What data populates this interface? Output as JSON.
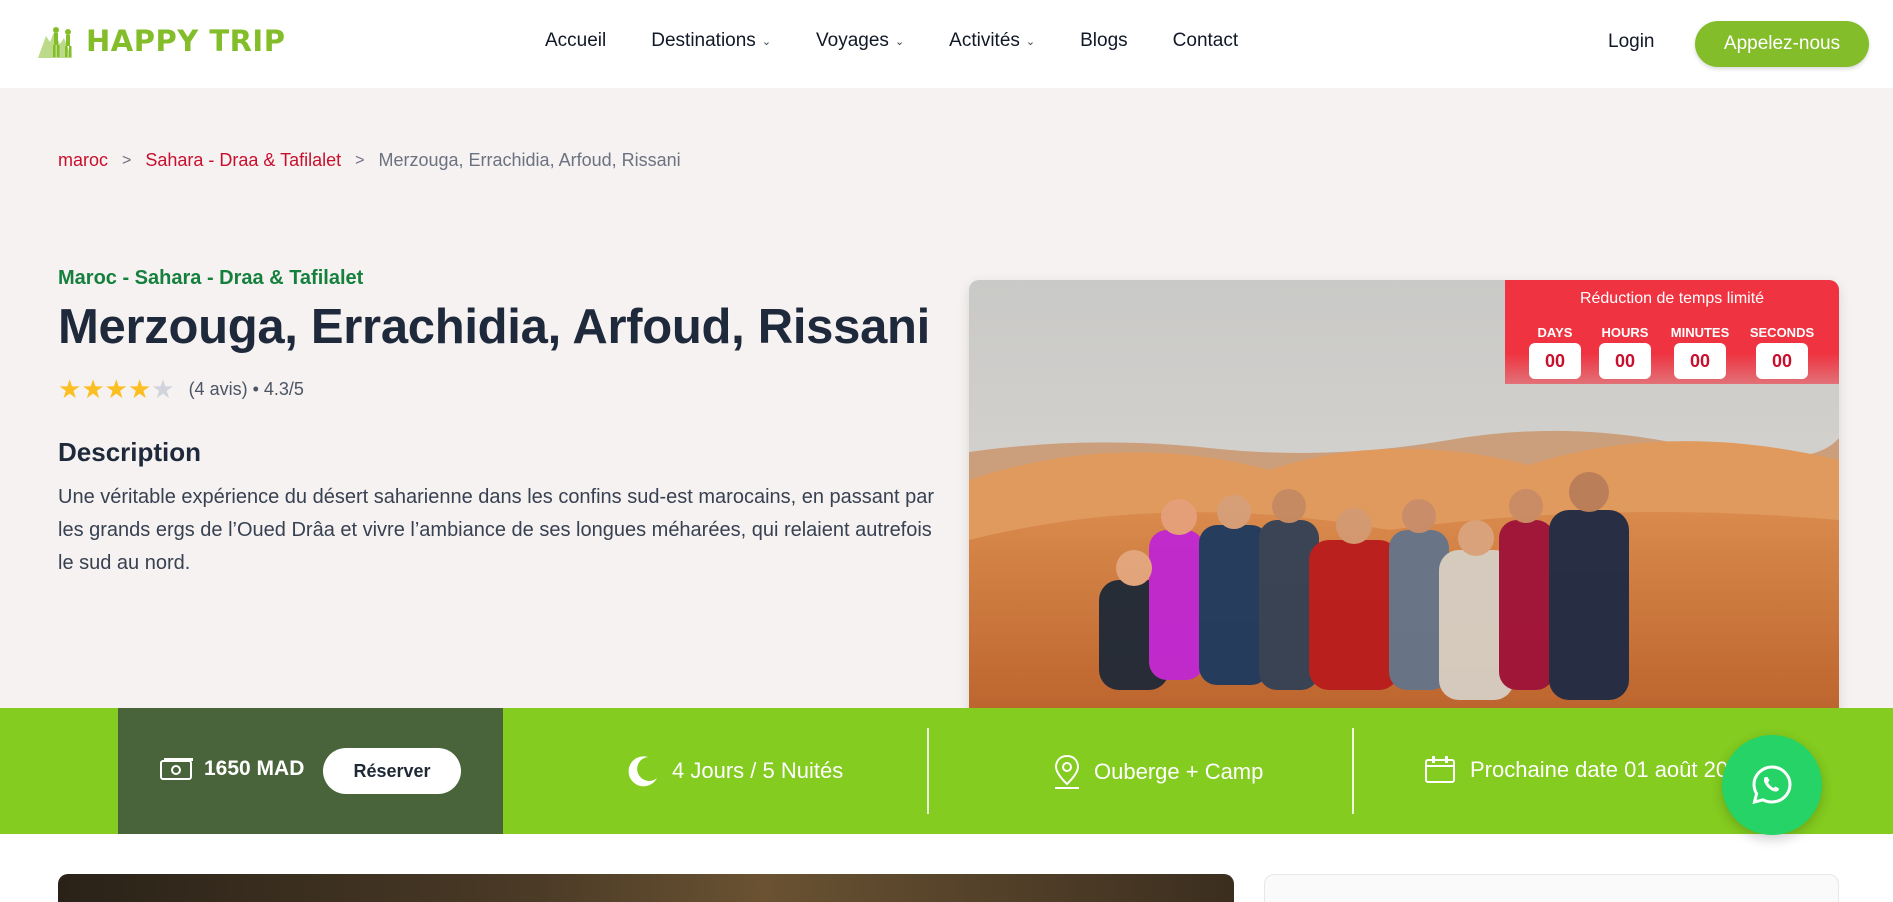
{
  "header": {
    "logo_text": "HAPPY TRIP",
    "nav": [
      {
        "label": "Accueil",
        "dropdown": false
      },
      {
        "label": "Destinations",
        "dropdown": true
      },
      {
        "label": "Voyages",
        "dropdown": true
      },
      {
        "label": "Activités",
        "dropdown": true
      },
      {
        "label": "Blogs",
        "dropdown": false
      },
      {
        "label": "Contact",
        "dropdown": false
      }
    ],
    "login": "Login",
    "call": "Appelez-nous"
  },
  "breadcrumb": {
    "items": [
      "maroc",
      "Sahara - Draa & Tafilalet"
    ],
    "current": "Merzouga, Errachidia, Arfoud, Rissani"
  },
  "tour": {
    "subtitle": "Maroc - Sahara - Draa & Tafilalet",
    "title": "Merzouga, Errachidia, Arfoud, Rissani",
    "rating_value": 4.3,
    "rating_text": "(4 avis) • 4.3/5",
    "description_title": "Description",
    "description": "Une véritable expérience du désert saharienne dans les confins sud-est marocains, en passant par les grands ergs de l’Oued Drâa et vivre l’ambiance de ses longues méharées, qui relaient autrefois le sud au nord."
  },
  "countdown": {
    "title": "Réduction de temps limité",
    "days_label": "DAYS",
    "days": "00",
    "hours_label": "HOURS",
    "hours": "00",
    "minutes_label": "MINUTES",
    "minutes": "00",
    "seconds_label": "SECONDS",
    "seconds": "00"
  },
  "infobar": {
    "price": "1650 MAD",
    "reserve": "Réserver",
    "duration": "4 Jours / 5 Nuités",
    "lodging": "Ouberge + Camp",
    "next_date": "Prochaine date 01 août 2025"
  },
  "colors": {
    "brand_green": "#84bd2a",
    "bar_green": "#84cc1f",
    "dark_green": "#49643a",
    "red": "#c8102e",
    "whatsapp": "#25d366"
  },
  "icons": [
    "money-icon",
    "moon-icon",
    "location-icon",
    "calendar-icon",
    "whatsapp-icon",
    "chevron-down-icon",
    "star-icon"
  ]
}
